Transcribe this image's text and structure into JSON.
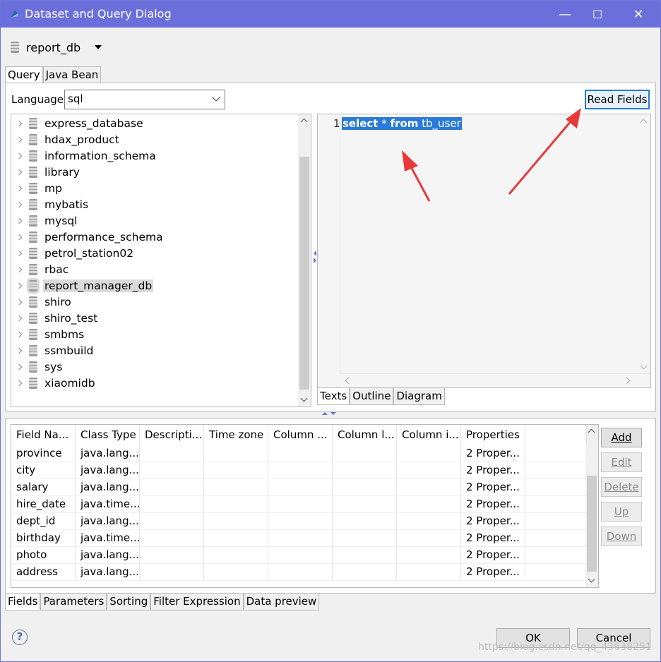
{
  "window": {
    "title": "Dataset and Query Dialog",
    "app_icon": "eclipse-icon",
    "minimize": "—",
    "maximize": "☐",
    "close": "✕"
  },
  "datasource": {
    "name": "report_db",
    "icon": "database-icon"
  },
  "top_tabs": [
    "Query",
    "Java Bean"
  ],
  "query": {
    "language_label": "Language",
    "language_value": "sql",
    "read_fields": "Read Fields"
  },
  "tree": {
    "selected": "report_manager_db",
    "items": [
      "express_database",
      "hdax_product",
      "information_schema",
      "library",
      "mp",
      "mybatis",
      "mysql",
      "performance_schema",
      "petrol_station02",
      "rbac",
      "report_manager_db",
      "shiro",
      "shiro_test",
      "smbms",
      "ssmbuild",
      "sys",
      "xiaomidb"
    ]
  },
  "editor": {
    "line_number": "1",
    "kw1": "select",
    "mid": " * ",
    "kw2": "from",
    "rest": " tb_user"
  },
  "editor_tabs": [
    "Texts",
    "Outline",
    "Diagram"
  ],
  "fields_table": {
    "columns": [
      "Field Na...",
      "Class Type",
      "Descripti...",
      "Time zone",
      "Column ...",
      "Column l...",
      "Column i...",
      "Properties"
    ],
    "rows": [
      [
        "province",
        "java.lang...",
        "",
        "",
        "",
        "",
        "",
        "2 Proper..."
      ],
      [
        "city",
        "java.lang...",
        "",
        "",
        "",
        "",
        "",
        "2 Proper..."
      ],
      [
        "salary",
        "java.lang...",
        "",
        "",
        "",
        "",
        "",
        "2 Proper..."
      ],
      [
        "hire_date",
        "java.time...",
        "",
        "",
        "",
        "",
        "",
        "2 Proper..."
      ],
      [
        "dept_id",
        "java.lang...",
        "",
        "",
        "",
        "",
        "",
        "2 Proper..."
      ],
      [
        "birthday",
        "java.time...",
        "",
        "",
        "",
        "",
        "",
        "2 Proper..."
      ],
      [
        "photo",
        "java.lang...",
        "",
        "",
        "",
        "",
        "",
        "2 Proper..."
      ],
      [
        "address",
        "java.lang...",
        "",
        "",
        "",
        "",
        "",
        "2 Proper..."
      ]
    ]
  },
  "side_buttons": [
    {
      "label": "Add",
      "enabled": true
    },
    {
      "label": "Edit",
      "enabled": false
    },
    {
      "label": "Delete",
      "enabled": false
    },
    {
      "label": "Up",
      "enabled": false
    },
    {
      "label": "Down",
      "enabled": false
    }
  ],
  "bottom_tabs": [
    "Fields",
    "Parameters",
    "Sorting",
    "Filter Expression",
    "Data preview"
  ],
  "footer": {
    "help": "?",
    "ok": "OK",
    "cancel": "Cancel",
    "watermark": "https://blog.csdn.net/qq_43638251"
  },
  "colors": {
    "titlebar": "#6b6fdb",
    "selection": "#2a7ad8",
    "annotation_arrow": "#e8393a"
  }
}
